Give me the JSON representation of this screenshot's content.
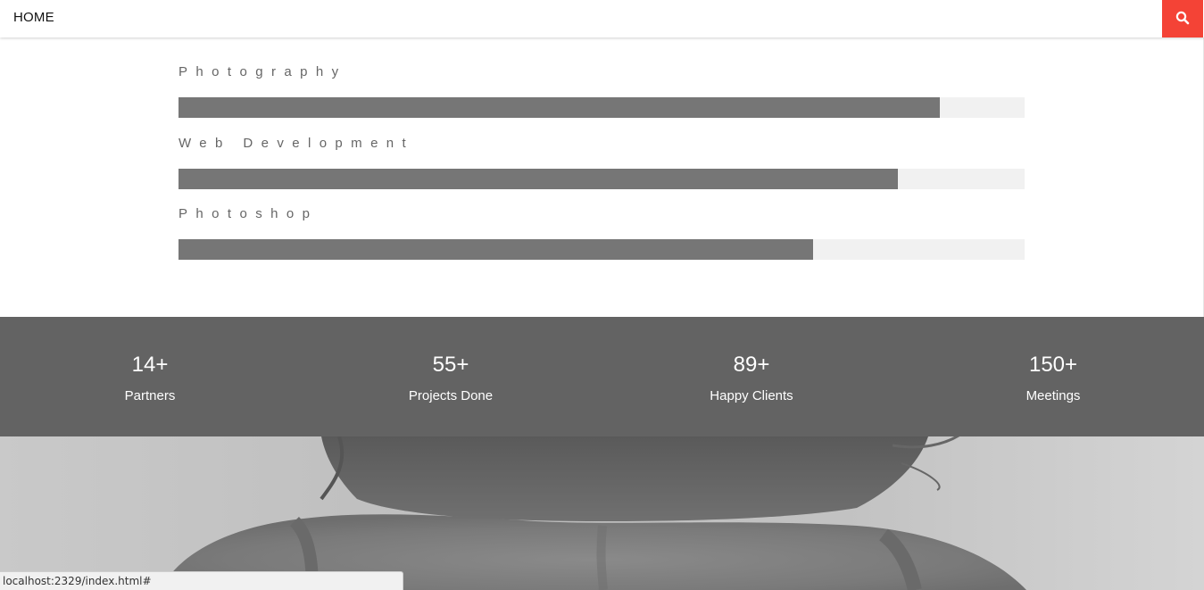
{
  "nav": {
    "home_label": "HOME",
    "search_icon": "search-icon",
    "accent_color": "#f44336"
  },
  "skills": [
    {
      "label": "Photography",
      "percent": 90
    },
    {
      "label": "Web Development",
      "percent": 85
    },
    {
      "label": "Photoshop",
      "percent": 75
    }
  ],
  "stats": [
    {
      "number": "14+",
      "label": "Partners"
    },
    {
      "number": "55+",
      "label": "Projects Done"
    },
    {
      "number": "89+",
      "label": "Happy Clients"
    },
    {
      "number": "150+",
      "label": "Meetings"
    }
  ],
  "status_bar": {
    "url": "localhost:2329/index.html#"
  }
}
